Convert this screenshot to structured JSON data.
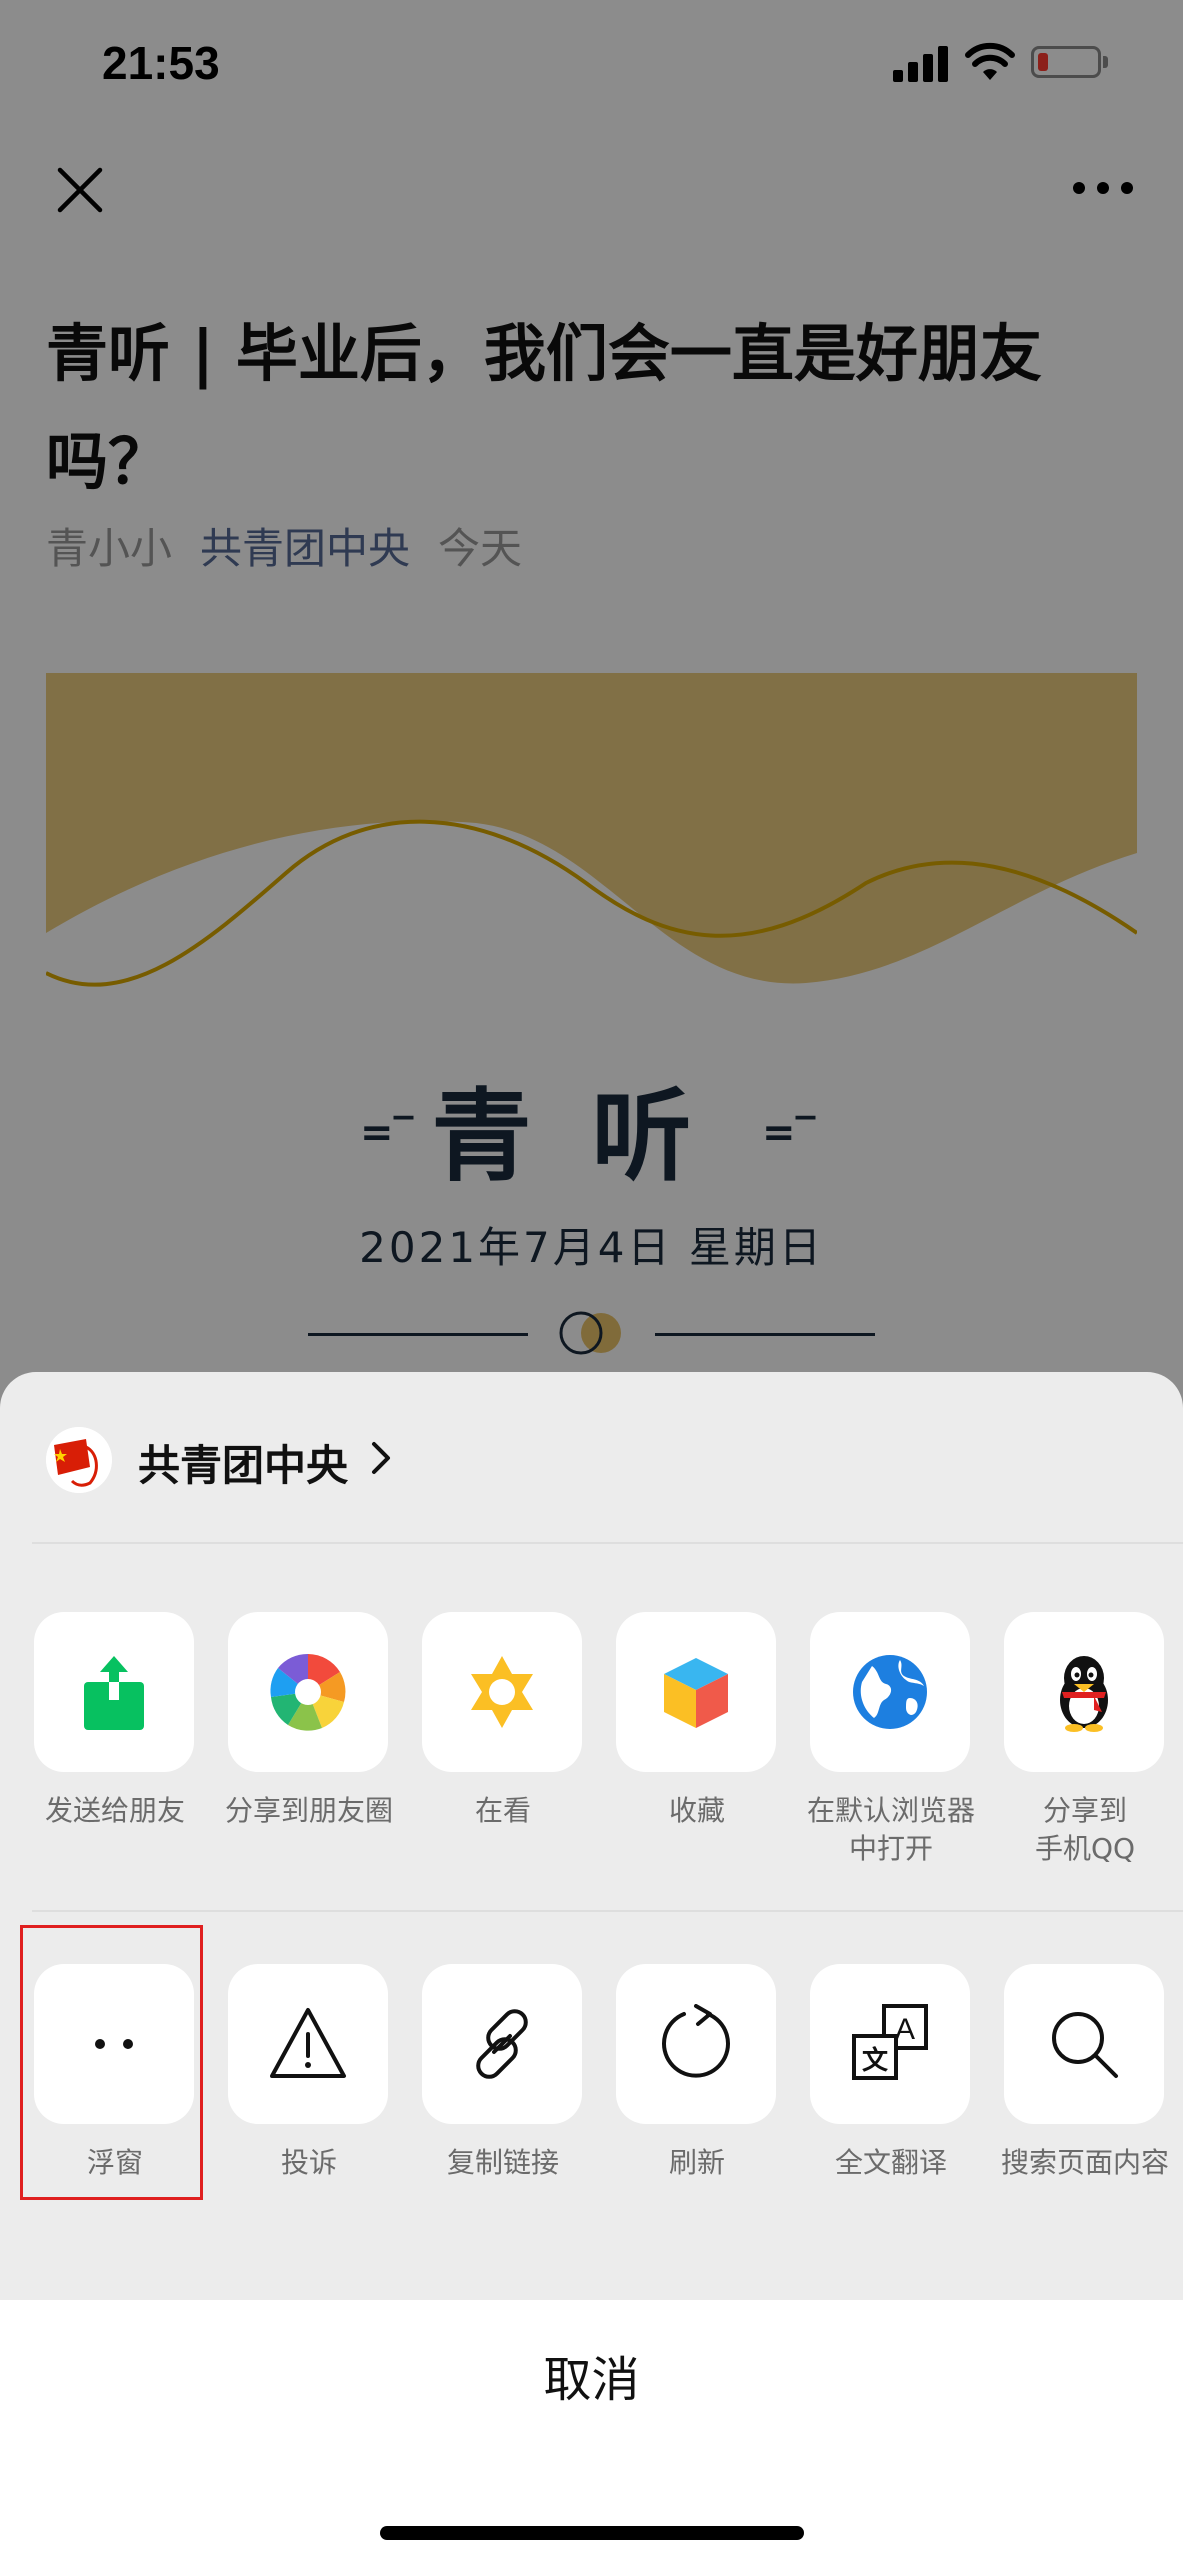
{
  "status_bar": {
    "time": "21:53"
  },
  "article": {
    "title": "青听 | 毕业后，我们会一直是好朋友吗？",
    "author": "青小小",
    "account": "共青团中央",
    "date_relative": "今天",
    "heading": "青听",
    "heading_deco_left": "=‾",
    "heading_deco_right": "=‾",
    "date": "2021年7月4日  星期日"
  },
  "share_sheet": {
    "account_name": "共青团中央",
    "row1": [
      {
        "label": "发送给朋友",
        "icon": "send-to-friend-icon"
      },
      {
        "label": "分享到朋友圈",
        "icon": "moments-icon"
      },
      {
        "label": "在看",
        "icon": "wow-icon"
      },
      {
        "label": "收藏",
        "icon": "favorite-cube-icon"
      },
      {
        "label": "在默认浏览器\n中打开",
        "icon": "browser-globe-icon"
      },
      {
        "label": "分享到\n手机QQ",
        "icon": "qq-penguin-icon"
      }
    ],
    "row2": [
      {
        "label": "浮窗",
        "icon": "float-window-icon"
      },
      {
        "label": "投诉",
        "icon": "warning-icon"
      },
      {
        "label": "复制链接",
        "icon": "link-icon"
      },
      {
        "label": "刷新",
        "icon": "refresh-icon"
      },
      {
        "label": "全文翻译",
        "icon": "translate-icon"
      },
      {
        "label": "搜索页面内容",
        "icon": "search-icon"
      }
    ],
    "cancel_label": "取消"
  },
  "colors": {
    "accent_link": "#576b95",
    "wechat_green": "#07c160",
    "banner_yellow": "#e9c46a",
    "highlight": "#e02020"
  }
}
